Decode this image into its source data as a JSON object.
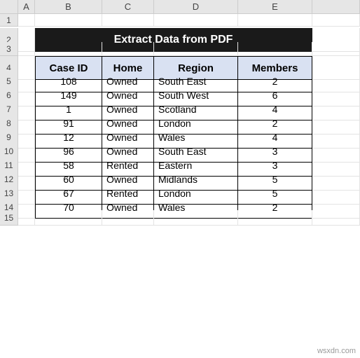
{
  "columns": [
    "A",
    "B",
    "C",
    "D",
    "E"
  ],
  "row_headers": [
    "1",
    "2",
    "3",
    "4",
    "5",
    "6",
    "7",
    "8",
    "9",
    "10",
    "11",
    "12",
    "13",
    "14",
    "15"
  ],
  "title": "Extract Data from PDF",
  "table": {
    "headers": [
      "Case ID",
      "Home",
      "Region",
      "Members"
    ],
    "rows": [
      {
        "case_id": "108",
        "home": "Owned",
        "region": "South East",
        "members": "2"
      },
      {
        "case_id": "149",
        "home": "Owned",
        "region": "South West",
        "members": "6"
      },
      {
        "case_id": "1",
        "home": "Owned",
        "region": "Scotland",
        "members": "4"
      },
      {
        "case_id": "91",
        "home": "Owned",
        "region": "London",
        "members": "2"
      },
      {
        "case_id": "12",
        "home": "Owned",
        "region": "Wales",
        "members": "4"
      },
      {
        "case_id": "96",
        "home": "Owned",
        "region": "South East",
        "members": "3"
      },
      {
        "case_id": "58",
        "home": "Rented",
        "region": "Eastern",
        "members": "3"
      },
      {
        "case_id": "60",
        "home": "Owned",
        "region": "Midlands",
        "members": "5"
      },
      {
        "case_id": "67",
        "home": "Rented",
        "region": "London",
        "members": "5"
      },
      {
        "case_id": "70",
        "home": "Owned",
        "region": "Wales",
        "members": "2"
      }
    ]
  },
  "watermark": "wsxdn.com",
  "chart_data": {
    "type": "table",
    "title": "Extract Data from PDF",
    "columns": [
      "Case ID",
      "Home",
      "Region",
      "Members"
    ],
    "rows": [
      [
        108,
        "Owned",
        "South East",
        2
      ],
      [
        149,
        "Owned",
        "South West",
        6
      ],
      [
        1,
        "Owned",
        "Scotland",
        4
      ],
      [
        91,
        "Owned",
        "London",
        2
      ],
      [
        12,
        "Owned",
        "Wales",
        4
      ],
      [
        96,
        "Owned",
        "South East",
        3
      ],
      [
        58,
        "Rented",
        "Eastern",
        3
      ],
      [
        60,
        "Owned",
        "Midlands",
        5
      ],
      [
        67,
        "Rented",
        "London",
        5
      ],
      [
        70,
        "Owned",
        "Wales",
        2
      ]
    ]
  }
}
